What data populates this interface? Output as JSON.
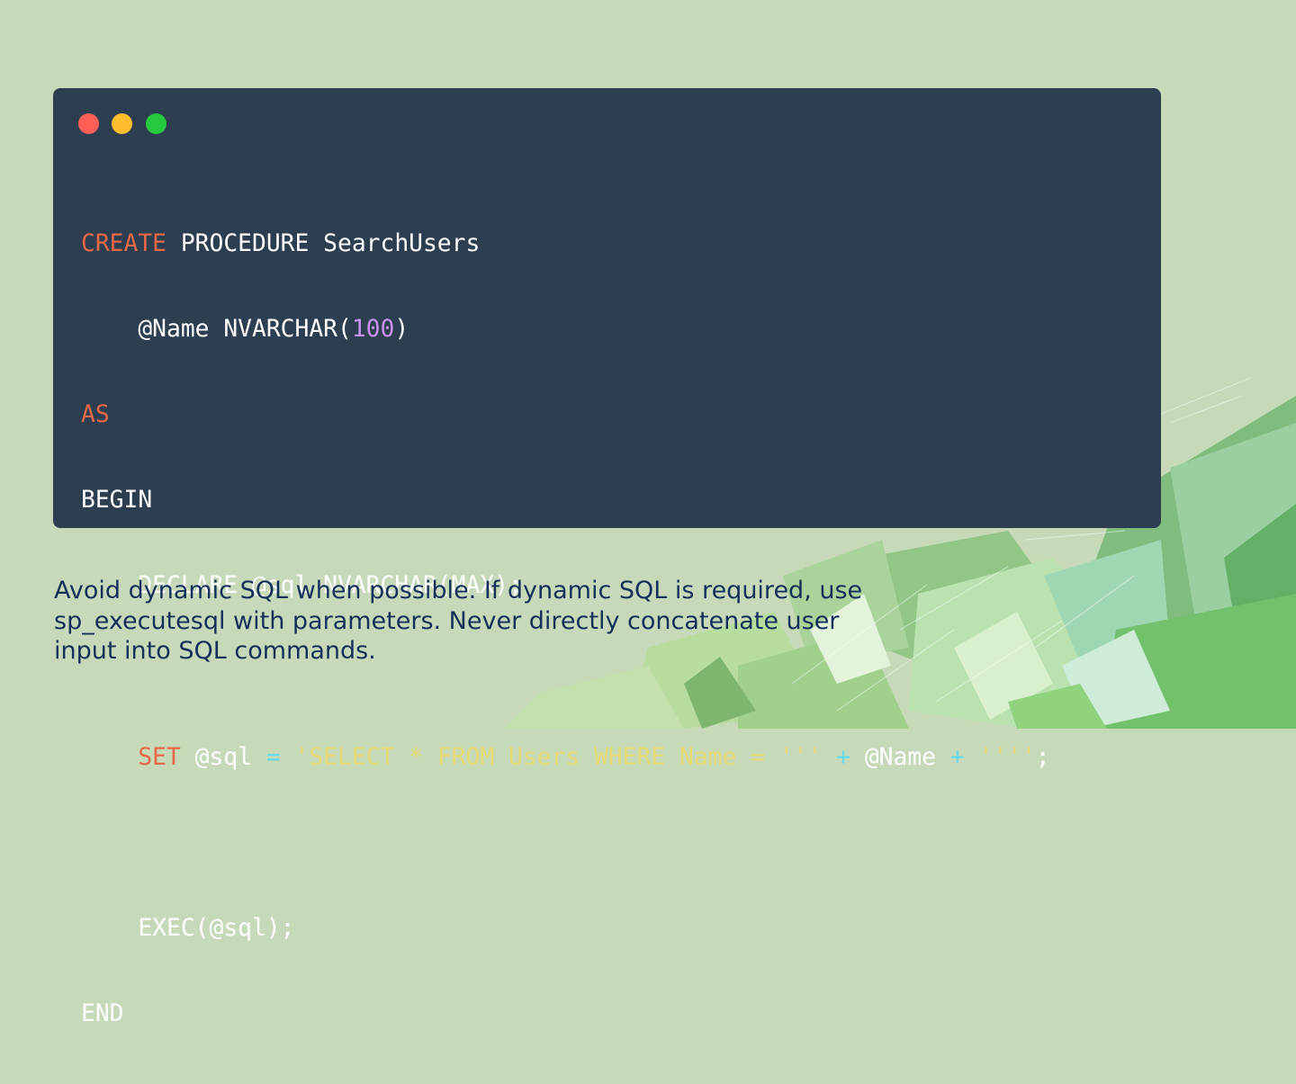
{
  "window_controls": {
    "close_color": "#ff5f56",
    "minimize_color": "#ffbd2e",
    "maximize_color": "#27c93f"
  },
  "code_lines": [
    {
      "tokens": [
        {
          "text": "CREATE",
          "kind": "keyword"
        },
        {
          "text": " PROCEDURE SearchUsers",
          "kind": "plain"
        }
      ]
    },
    {
      "tokens": [
        {
          "text": "    @Name NVARCHAR(",
          "kind": "plain"
        },
        {
          "text": "100",
          "kind": "number"
        },
        {
          "text": ")",
          "kind": "plain"
        }
      ]
    },
    {
      "tokens": [
        {
          "text": "AS",
          "kind": "keyword"
        }
      ]
    },
    {
      "tokens": [
        {
          "text": "BEGIN",
          "kind": "plain"
        }
      ]
    },
    {
      "tokens": [
        {
          "text": "    DECLARE @sql NVARCHAR(MAX);",
          "kind": "plain"
        }
      ]
    },
    {
      "tokens": []
    },
    {
      "tokens": [
        {
          "text": "    ",
          "kind": "plain"
        },
        {
          "text": "SET",
          "kind": "keyword"
        },
        {
          "text": " @sql ",
          "kind": "plain"
        },
        {
          "text": "=",
          "kind": "op"
        },
        {
          "text": " ",
          "kind": "plain"
        },
        {
          "text": "'SELECT * FROM Users WHERE Name = '''",
          "kind": "string"
        },
        {
          "text": " ",
          "kind": "plain"
        },
        {
          "text": "+",
          "kind": "op"
        },
        {
          "text": " @Name ",
          "kind": "plain"
        },
        {
          "text": "+",
          "kind": "op"
        },
        {
          "text": " ",
          "kind": "plain"
        },
        {
          "text": "''''",
          "kind": "string"
        },
        {
          "text": ";",
          "kind": "plain"
        }
      ]
    },
    {
      "tokens": []
    },
    {
      "tokens": [
        {
          "text": "    EXEC(@sql);",
          "kind": "plain"
        }
      ]
    },
    {
      "tokens": [
        {
          "text": "END",
          "kind": "plain"
        }
      ]
    }
  ],
  "syntax_colors": {
    "keyword": "#e8684a",
    "number": "#c792ea",
    "string": "#e6db74",
    "op": "#66d9ef",
    "plain": "#ffffff"
  },
  "note_text": "Avoid dynamic SQL when possible. If dynamic SQL is required, use sp_executesql with parameters. Never directly concatenate user input into SQL commands."
}
